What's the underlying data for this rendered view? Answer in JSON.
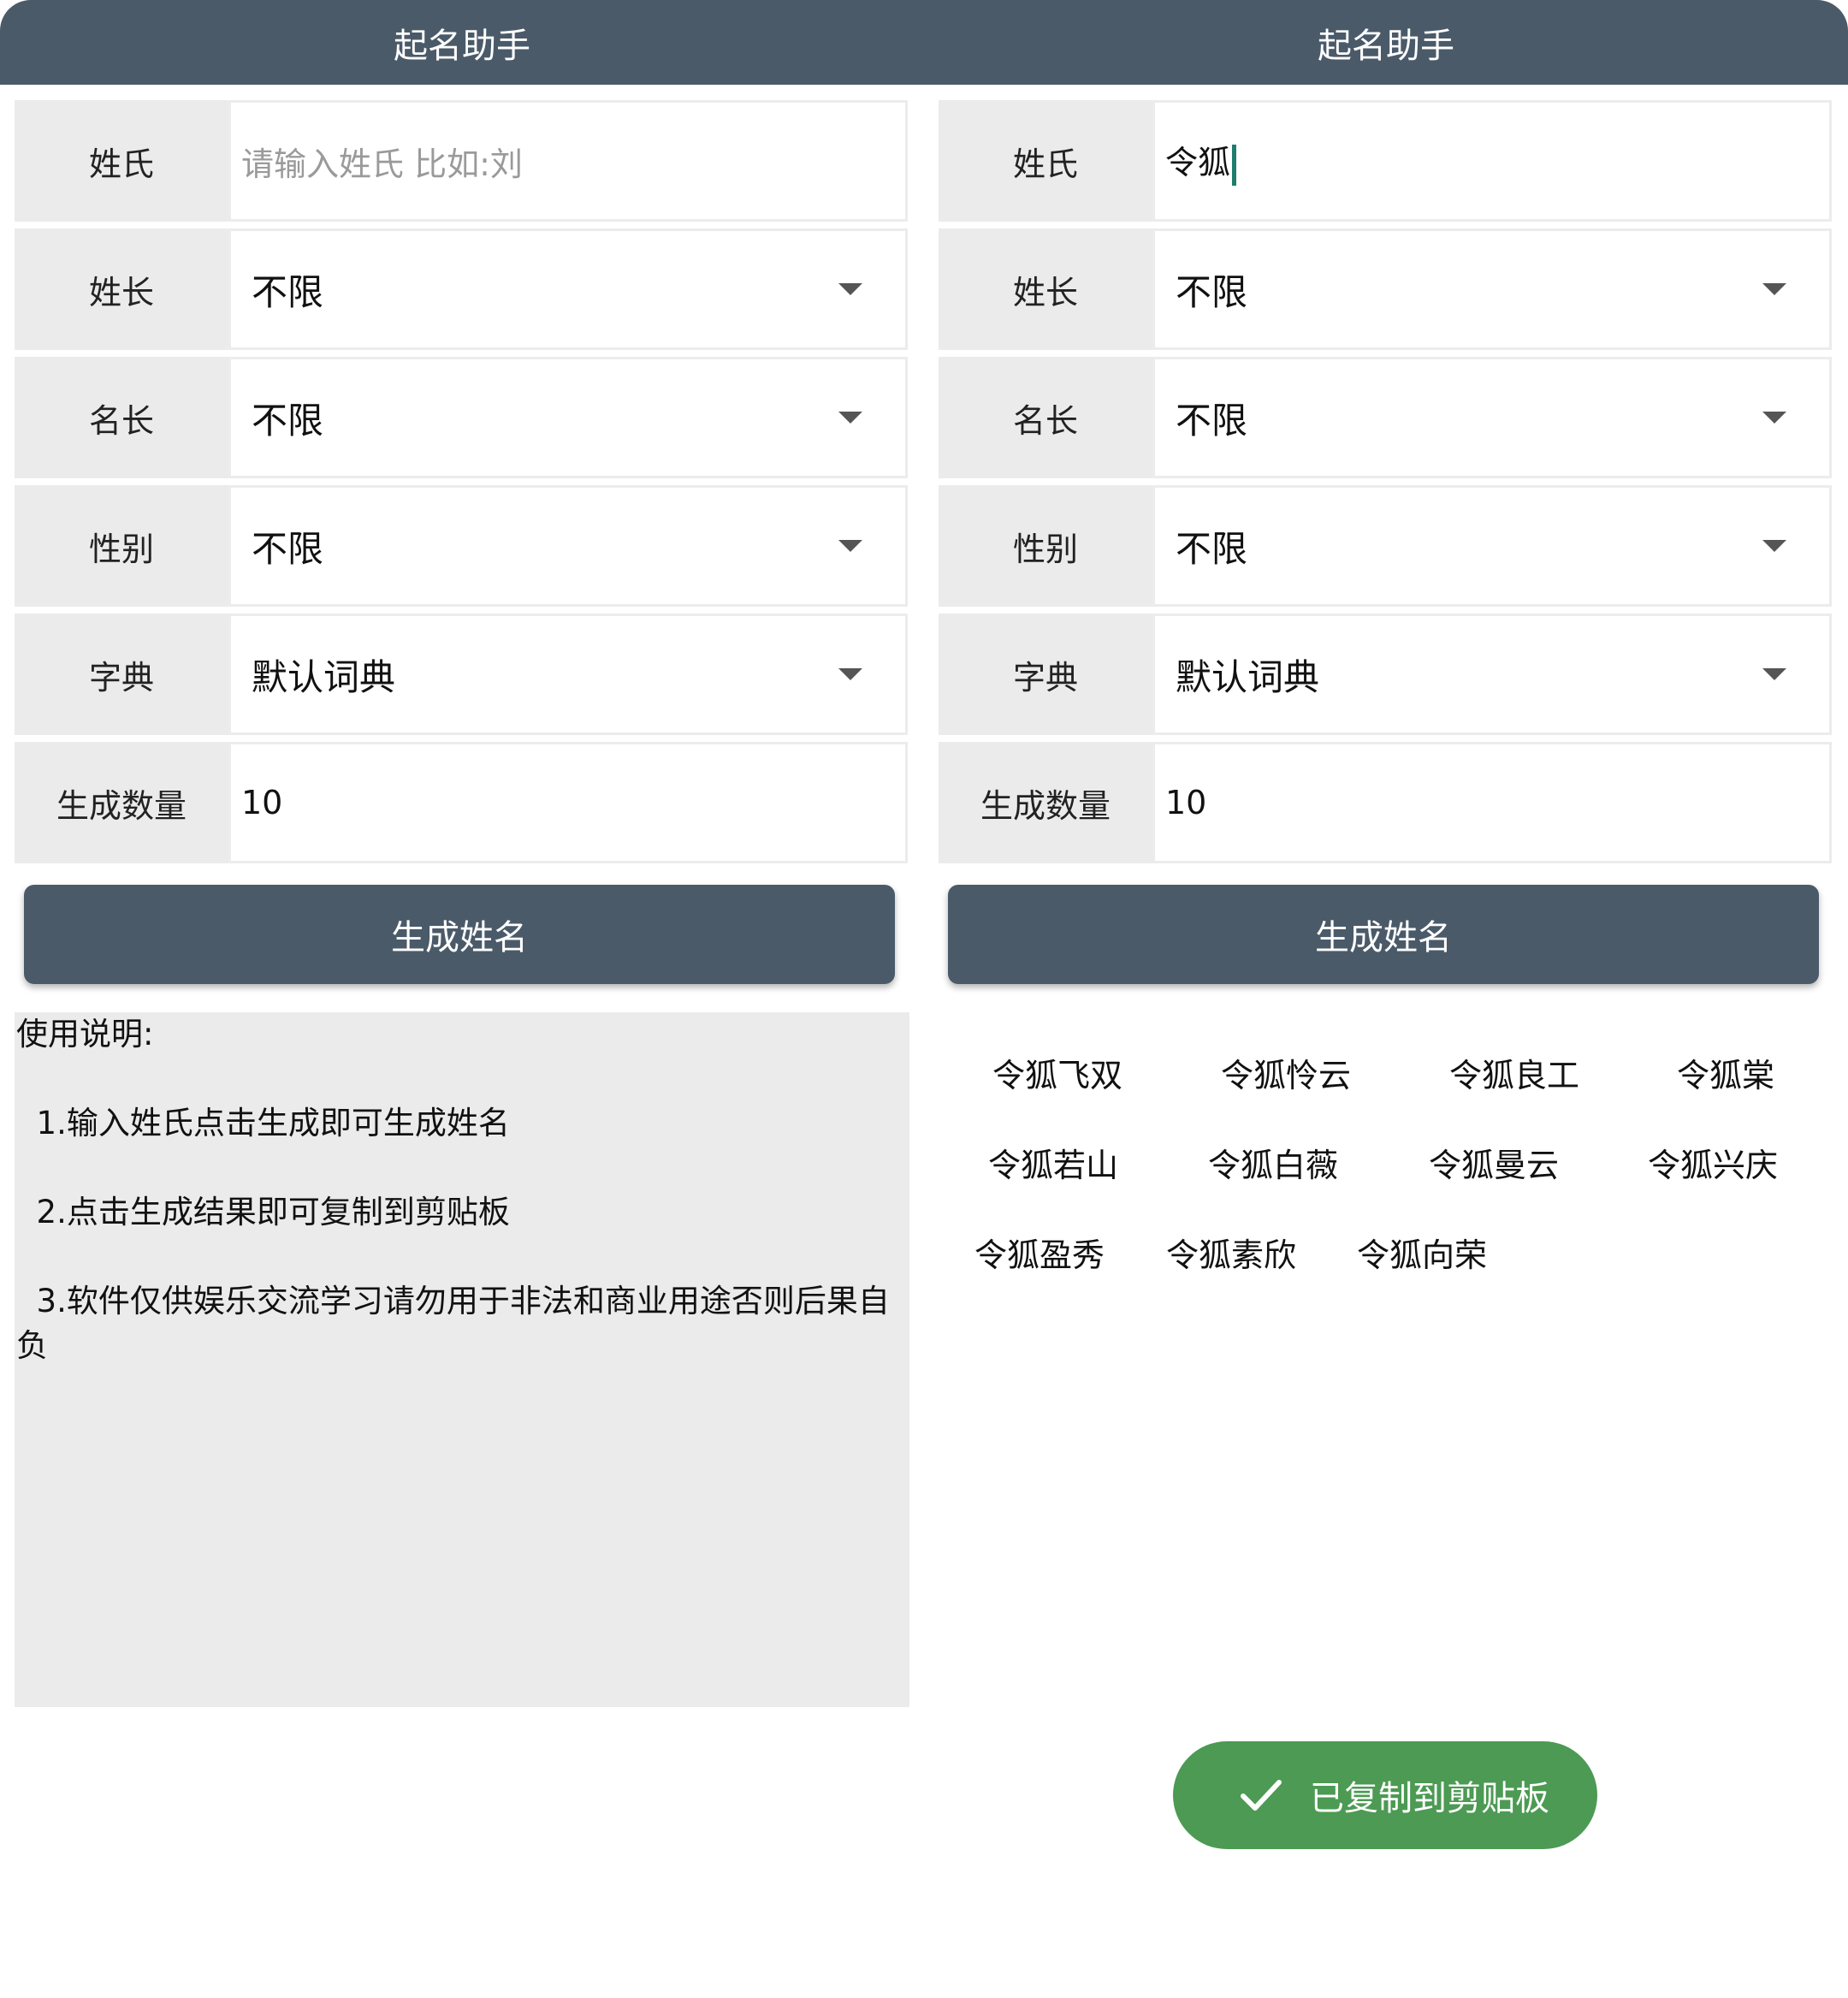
{
  "left_panel": {
    "header": {
      "title": "起名助手"
    },
    "form": {
      "surname": {
        "label": "姓氏",
        "value": "",
        "placeholder": "请输入姓氏 比如:刘"
      },
      "surname_length": {
        "label": "姓长",
        "value": "不限"
      },
      "name_length": {
        "label": "名长",
        "value": "不限"
      },
      "gender": {
        "label": "性别",
        "value": "不限"
      },
      "dictionary": {
        "label": "字典",
        "value": "默认词典"
      },
      "count": {
        "label": "生成数量",
        "value": "10"
      }
    },
    "generate_label": "生成姓名",
    "instructions": {
      "title": "使用说明:",
      "item1": "  1.输入姓氏点击生成即可生成姓名",
      "item2": "  2.点击生成结果即可复制到剪贴板",
      "item3": "  3.软件仅供娱乐交流学习请勿用于非法和商业用途否则后果自负"
    }
  },
  "right_panel": {
    "header": {
      "title": "起名助手"
    },
    "form": {
      "surname": {
        "label": "姓氏",
        "value": "令狐"
      },
      "surname_length": {
        "label": "姓长",
        "value": "不限"
      },
      "name_length": {
        "label": "名长",
        "value": "不限"
      },
      "gender": {
        "label": "性别",
        "value": "不限"
      },
      "dictionary": {
        "label": "字典",
        "value": "默认词典"
      },
      "count": {
        "label": "生成数量",
        "value": "10"
      }
    },
    "generate_label": "生成姓名",
    "results": [
      "令狐飞双",
      "令狐怜云",
      "令狐良工",
      "令狐棠",
      "令狐若山",
      "令狐白薇",
      "令狐曼云",
      "令狐兴庆",
      "令狐盈秀",
      "令狐素欣",
      "令狐向荣"
    ],
    "toast": {
      "text": "已复制到剪贴板",
      "icon": "check-icon"
    }
  },
  "colors": {
    "header_bg": "#4a5a69",
    "label_bg": "#ebebeb",
    "toast_bg": "#4c9a53",
    "cursor": "#1e7d6d"
  }
}
